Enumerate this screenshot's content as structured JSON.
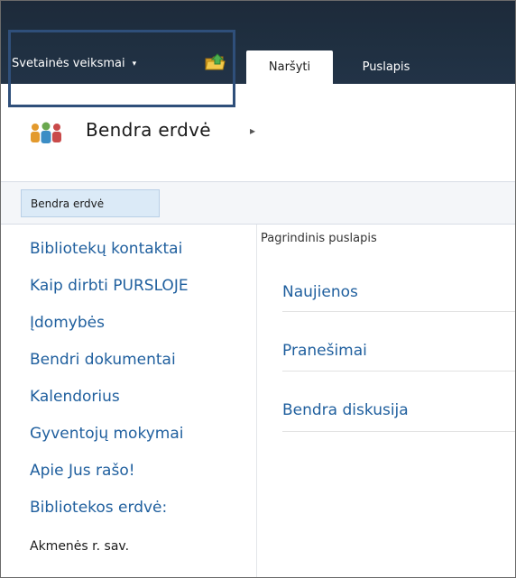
{
  "ribbon": {
    "site_actions_label": "Svetainės veiksmai",
    "site_actions_caret": "▾",
    "nav_up_icon": "folder-up-arrow-icon",
    "tabs": [
      {
        "label": "Naršyti",
        "active": true
      },
      {
        "label": "Puslapis",
        "active": false
      }
    ]
  },
  "title_area": {
    "site_icon": "people-group-icon",
    "title": "Bendra erdvė",
    "arrow": "▸"
  },
  "topbar": {
    "items": [
      {
        "label": "Bendra erdvė"
      }
    ]
  },
  "quicklaunch": {
    "items": [
      {
        "label": "Bibliotekų kontaktai"
      },
      {
        "label": "Kaip dirbti PURSLOJE"
      },
      {
        "label": "Įdomybės"
      },
      {
        "label": "Bendri dokumentai"
      },
      {
        "label": "Kalendorius"
      },
      {
        "label": "Gyventojų mokymai"
      },
      {
        "label": "Apie Jus rašo!"
      },
      {
        "label": "Bibliotekos erdvė:"
      }
    ],
    "footer_text": "Akmenės r. sav."
  },
  "main": {
    "section_label": "Pagrindinis puslapis",
    "links": [
      {
        "label": "Naujienos"
      },
      {
        "label": "Pranešimai"
      },
      {
        "label": "Bendra diskusija"
      }
    ]
  },
  "colors": {
    "ribbon_bg": "#1f2f40",
    "highlight_border": "#2f4f7a",
    "link": "#1f5f9e",
    "topbar_item_bg": "#dbeaf7"
  }
}
